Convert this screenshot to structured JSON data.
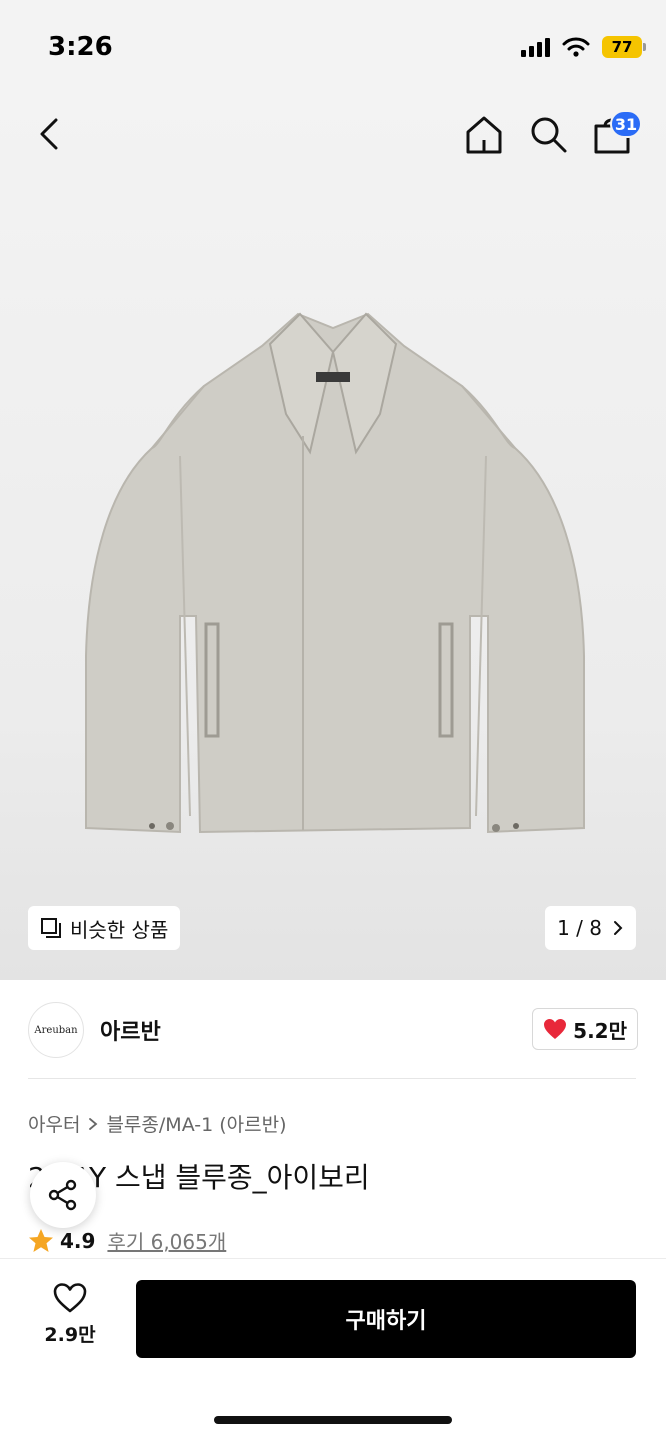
{
  "status_bar": {
    "time": "3:26",
    "battery": "77"
  },
  "nav": {
    "cart_count": "31"
  },
  "gallery": {
    "similar_label": "비슷한 상품",
    "counter": "1 / 8"
  },
  "brand": {
    "logo_text": "Areuban",
    "name": "아르반",
    "likes": "5.2만"
  },
  "breadcrumb": {
    "category": "아우터",
    "subcategory": "블루종/MA-1 (아르반)"
  },
  "product": {
    "title": "2WAY 스냅 블루종_아이보리",
    "rating": "4.9",
    "reviews": "후기 6,065개"
  },
  "bottom_bar": {
    "wish_count": "2.9만",
    "buy_label": "구매하기"
  },
  "colors": {
    "accent_blue": "#2b6cf6",
    "heart_red": "#e8283a",
    "star_orange": "#f5a623",
    "battery_yellow": "#f5c400"
  }
}
